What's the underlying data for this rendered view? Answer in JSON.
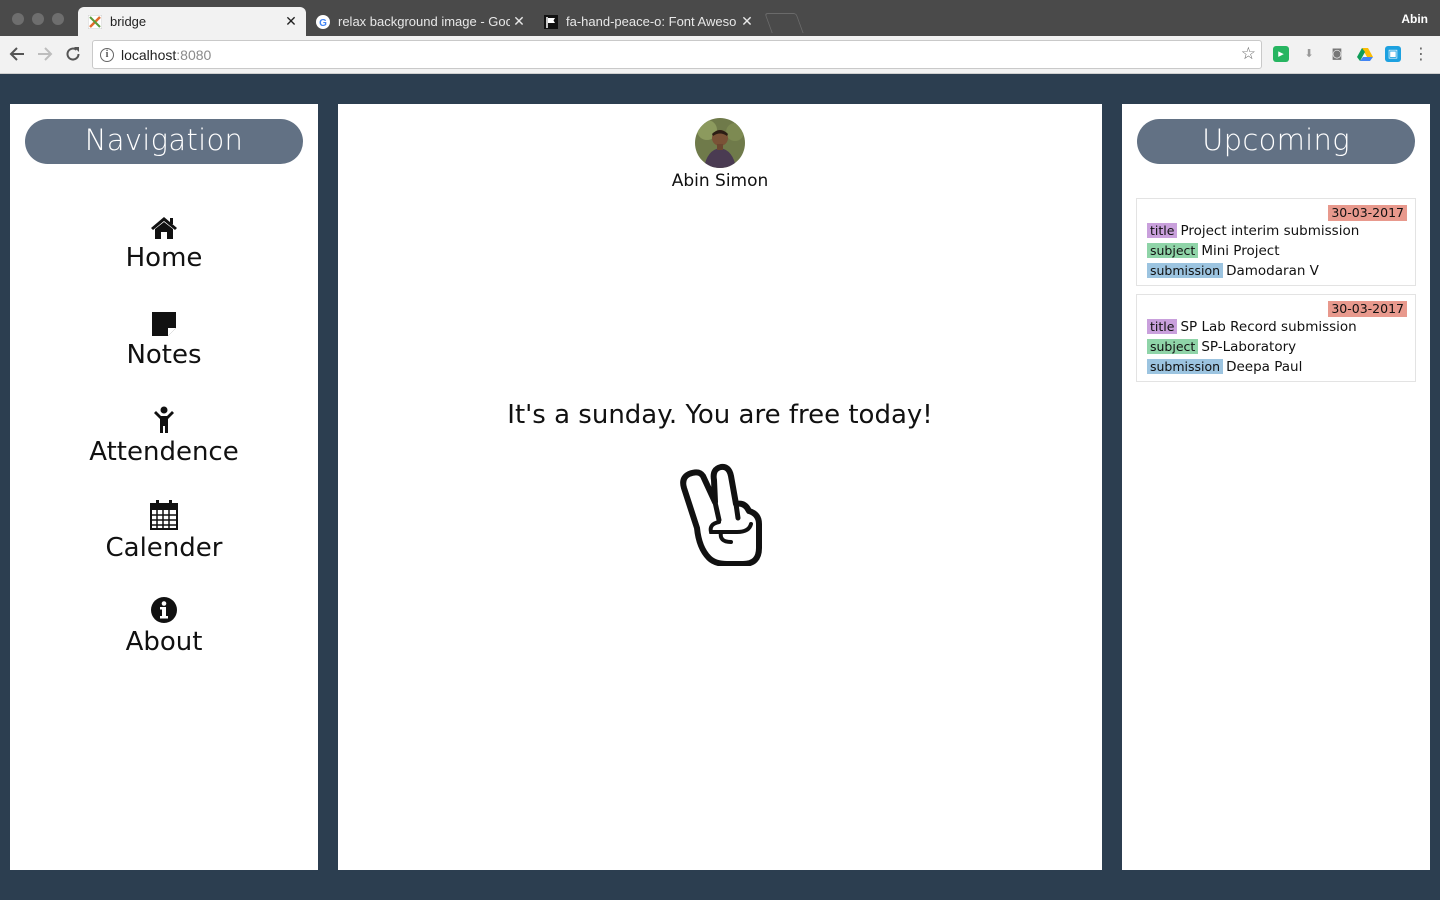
{
  "browser": {
    "tabs": [
      {
        "label": "bridge",
        "favicon": "bridge-favicon",
        "active": true
      },
      {
        "label": "relax background image - Goo",
        "favicon": "google-favicon",
        "active": false
      },
      {
        "label": "fa-hand-peace-o: Font Aweso",
        "favicon": "flag-favicon",
        "active": false
      }
    ],
    "close_glyph": "✕",
    "profile_name": "Abin",
    "url_host": "localhost",
    "url_port": ":8080"
  },
  "navigation": {
    "title": "Navigation",
    "items": [
      {
        "label": "Home",
        "icon": "home-icon"
      },
      {
        "label": "Notes",
        "icon": "sticky-note-icon"
      },
      {
        "label": "Attendence",
        "icon": "child-icon"
      },
      {
        "label": "Calender",
        "icon": "calendar-icon"
      },
      {
        "label": "About",
        "icon": "info-circle-icon"
      }
    ]
  },
  "main": {
    "user_name": "Abin Simon",
    "message": "It's a sunday. You are free today!",
    "icon": "hand-peace-icon"
  },
  "upcoming": {
    "title": "Upcoming",
    "field_labels": {
      "title": "title",
      "subject": "subject",
      "submission": "submission"
    },
    "items": [
      {
        "date": "30-03-2017",
        "title": "Project interim submission",
        "subject": "Mini Project",
        "submission": "Damodaran V"
      },
      {
        "date": "30-03-2017",
        "title": "SP Lab Record submission",
        "subject": "SP-Laboratory",
        "submission": "Deepa Paul"
      }
    ]
  },
  "colors": {
    "background": "#2c3e50",
    "panel_header": "#627184",
    "date_badge": "#e8998d",
    "title_tag": "#c9a0dc",
    "subject_tag": "#8fd4a8",
    "submission_tag": "#9cc4e0"
  }
}
